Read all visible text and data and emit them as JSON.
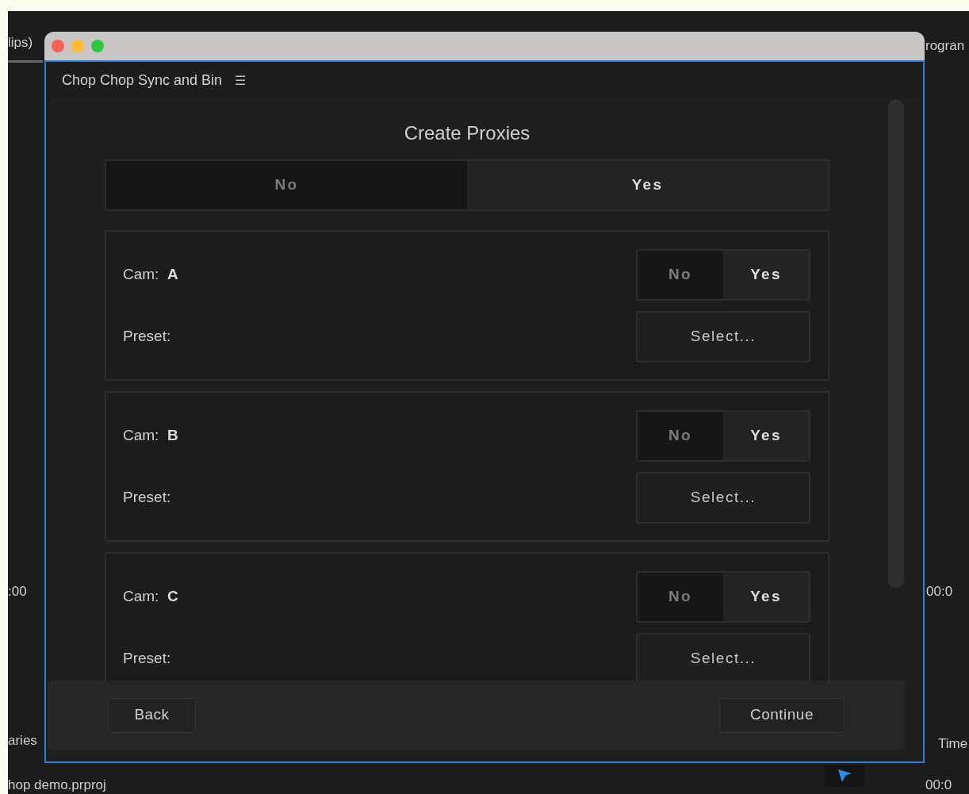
{
  "background": {
    "top_left_tab": "lips)",
    "top_right_tab": "rogran",
    "left_timecode": ":00",
    "right_timecode": "00:0",
    "bottom_left_tab": "aries",
    "bottom_right_tab": "Time",
    "project_file": "hop demo.prproj",
    "bottom_right_timecode": "00:0"
  },
  "panel": {
    "title": "Chop Chop Sync and Bin",
    "menu_glyph": "☰"
  },
  "heading": "Create Proxies",
  "master_toggle": [
    {
      "label": "No",
      "selected": false
    },
    {
      "label": "Yes",
      "selected": true
    }
  ],
  "cameras": [
    {
      "label": "Cam:",
      "name": "A",
      "toggle": [
        {
          "label": "No",
          "selected": false
        },
        {
          "label": "Yes",
          "selected": true
        }
      ],
      "preset_label": "Preset:",
      "preset_button": "Select..."
    },
    {
      "label": "Cam:",
      "name": "B",
      "toggle": [
        {
          "label": "No",
          "selected": false
        },
        {
          "label": "Yes",
          "selected": true
        }
      ],
      "preset_label": "Preset:",
      "preset_button": "Select..."
    },
    {
      "label": "Cam:",
      "name": "C",
      "toggle": [
        {
          "label": "No",
          "selected": false
        },
        {
          "label": "Yes",
          "selected": true
        }
      ],
      "preset_label": "Preset:",
      "preset_button": "Select..."
    }
  ],
  "footer": {
    "back": "Back",
    "continue": "Continue"
  }
}
